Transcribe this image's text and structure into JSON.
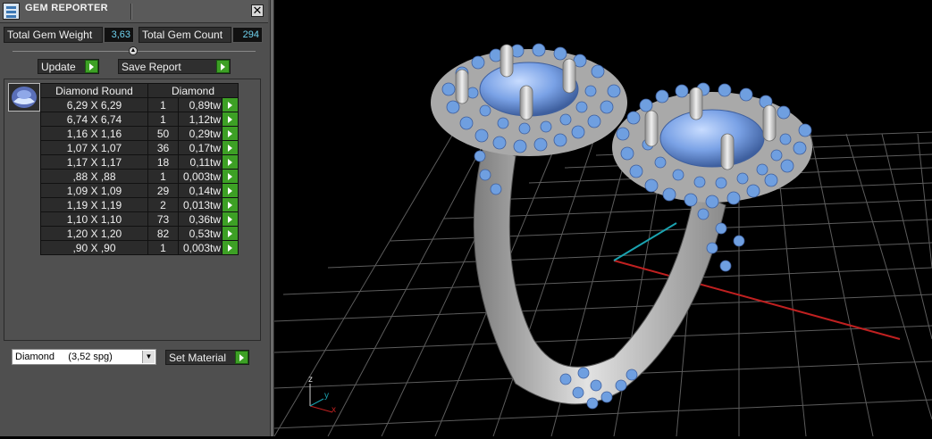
{
  "window": {
    "title": "GEM REPORTER",
    "close_glyph": "✕"
  },
  "stats": {
    "weight_label": "Total Gem Weight",
    "weight_value": "3,63",
    "count_label": "Total Gem Count",
    "count_value": "294"
  },
  "actions": {
    "update_label": "Update",
    "save_label": "Save Report"
  },
  "table": {
    "columns": [
      "Diamond Round",
      "Diamond"
    ],
    "rows": [
      {
        "size": "6,29 X 6,29",
        "count": "1",
        "weight": "0,89tw"
      },
      {
        "size": "6,74 X 6,74",
        "count": "1",
        "weight": "1,12tw"
      },
      {
        "size": "1,16 X 1,16",
        "count": "50",
        "weight": "0,29tw"
      },
      {
        "size": "1,07 X 1,07",
        "count": "36",
        "weight": "0,17tw"
      },
      {
        "size": "1,17 X 1,17",
        "count": "18",
        "weight": "0,11tw"
      },
      {
        "size": ",88 X ,88",
        "count": "1",
        "weight": "0,003tw"
      },
      {
        "size": "1,09 X 1,09",
        "count": "29",
        "weight": "0,14tw"
      },
      {
        "size": "1,19 X 1,19",
        "count": "2",
        "weight": "0,013tw"
      },
      {
        "size": "1,10 X 1,10",
        "count": "73",
        "weight": "0,36tw"
      },
      {
        "size": "1,20 X 1,20",
        "count": "82",
        "weight": "0,53tw"
      },
      {
        "size": ",90 X ,90",
        "count": "1",
        "weight": "0,003tw"
      }
    ]
  },
  "material": {
    "selected": "Diamond     (3,52 spg)",
    "set_label": "Set Material"
  },
  "viewport": {
    "axis_x": "x",
    "axis_y": "y",
    "axis_z": "z"
  },
  "colors": {
    "accent_green": "#3da025",
    "value_cyan": "#6fd3f0",
    "gem_blue": "#6f9fe0",
    "metal_gray": "#bdbdbd"
  },
  "icons": [
    "gem-reporter-app-icon",
    "close-icon",
    "collapse-icon",
    "play-arrow-icon",
    "dropdown-arrow-icon",
    "diamond-round-icon"
  ]
}
